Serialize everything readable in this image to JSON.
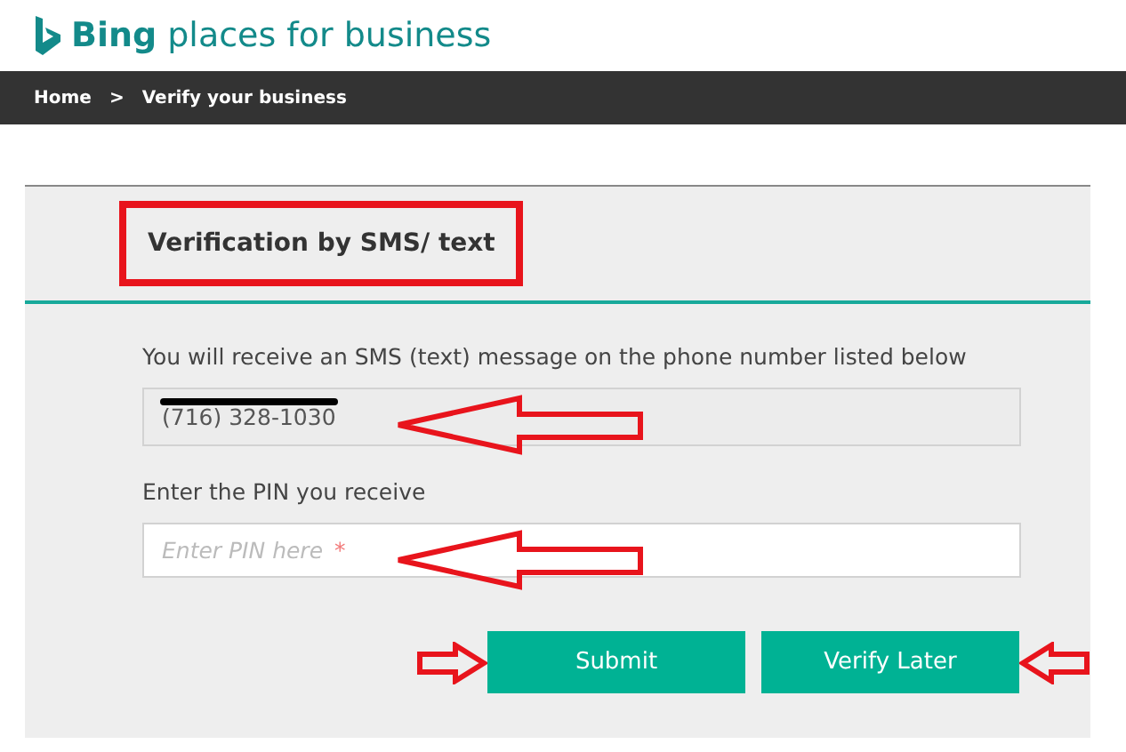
{
  "header": {
    "brand": "Bing",
    "title": "places for business"
  },
  "breadcrumb": [
    {
      "label": "Home"
    },
    {
      "label": "Verify your business"
    }
  ],
  "breadcrumb_separator": ">",
  "panel": {
    "heading": "Verification by SMS/ text",
    "heading_highlighted": true,
    "intro": "You will receive an SMS (text) message on the phone number listed below",
    "phone": {
      "value": "(716) 328-1030",
      "redacted": true,
      "annotated": true
    },
    "pin_label": "Enter the PIN you receive",
    "pin": {
      "placeholder": "Enter PIN here",
      "required_mark": "*",
      "annotated": true
    },
    "buttons": [
      {
        "label": "Submit",
        "annotated": true
      },
      {
        "label": "Verify Later",
        "annotated": true
      }
    ]
  }
}
